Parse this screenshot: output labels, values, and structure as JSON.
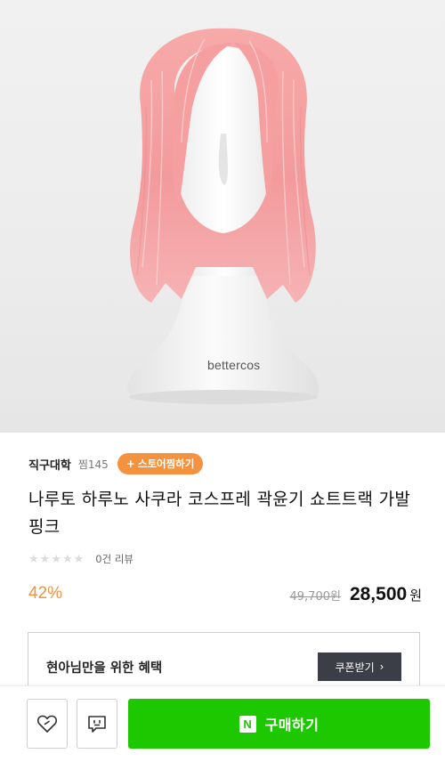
{
  "product": {
    "image_watermark": "bettercos",
    "store_name": "직구대학",
    "wish_count": "찜145",
    "store_fav_label": "스토어찜하기",
    "title": "나루토 하루노 사쿠라 코스프레 곽윤기 쇼트트랙 가발 핑크",
    "rating_stars": 0,
    "review_count": "0건 리뷰",
    "discount": "42%",
    "original_price": "49,700원",
    "sale_price": "28,500",
    "currency": "원"
  },
  "benefit": {
    "title": "현아님만을 위한 혜택",
    "coupon_label": "쿠폰받기"
  },
  "bottom_bar": {
    "npay_badge": "N",
    "buy_label": "구매하기"
  },
  "colors": {
    "accent_orange": "#f4923f",
    "buy_green": "#1ec800",
    "coupon_dark": "#3b3e47",
    "wig_pink": "#f5a3a6"
  },
  "icons": [
    "heart-icon",
    "chat-icon",
    "star-icon",
    "chevron-right-icon",
    "plus-icon"
  ]
}
